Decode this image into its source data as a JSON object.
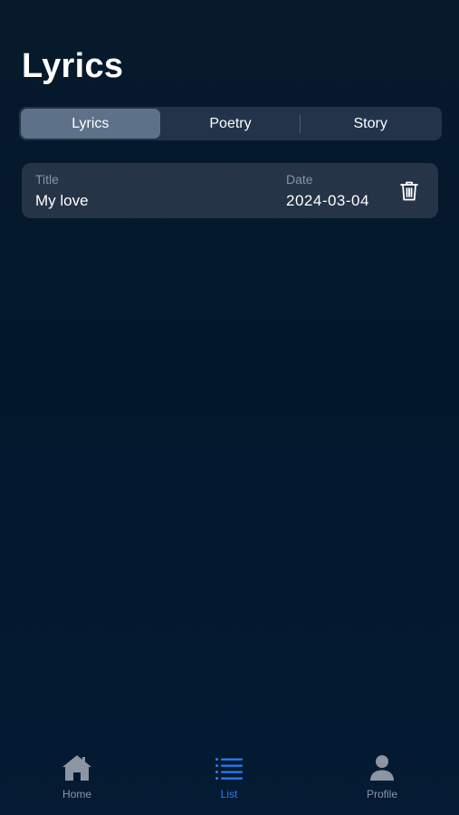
{
  "header": {
    "title": "Lyrics"
  },
  "segments": [
    {
      "label": "Lyrics",
      "active": true
    },
    {
      "label": "Poetry",
      "active": false
    },
    {
      "label": "Story",
      "active": false
    }
  ],
  "entries": [
    {
      "title_label": "Title",
      "title": "My love",
      "date_label": "Date",
      "date": "2024-03-04",
      "delete_icon": "trash-icon"
    }
  ],
  "tabbar": {
    "items": [
      {
        "label": "Home",
        "icon": "home-icon",
        "active": false
      },
      {
        "label": "List",
        "icon": "list-icon",
        "active": true
      },
      {
        "label": "Profile",
        "icon": "person-icon",
        "active": false
      }
    ],
    "active_color": "#2e7cf6",
    "inactive_color": "#8d95a2"
  },
  "colors": {
    "background": "#03172c",
    "card": "#253447",
    "segment_active": "#5d7189"
  }
}
